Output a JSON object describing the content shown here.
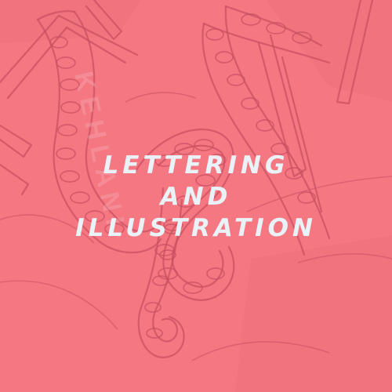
{
  "tile": {
    "background_color": "#f47781",
    "line_color": "#c94f62",
    "text_color": "#e9f2f7"
  },
  "headline": {
    "line1": "LETTERING",
    "line2": "AND",
    "line3": "ILLUSTRATION"
  }
}
